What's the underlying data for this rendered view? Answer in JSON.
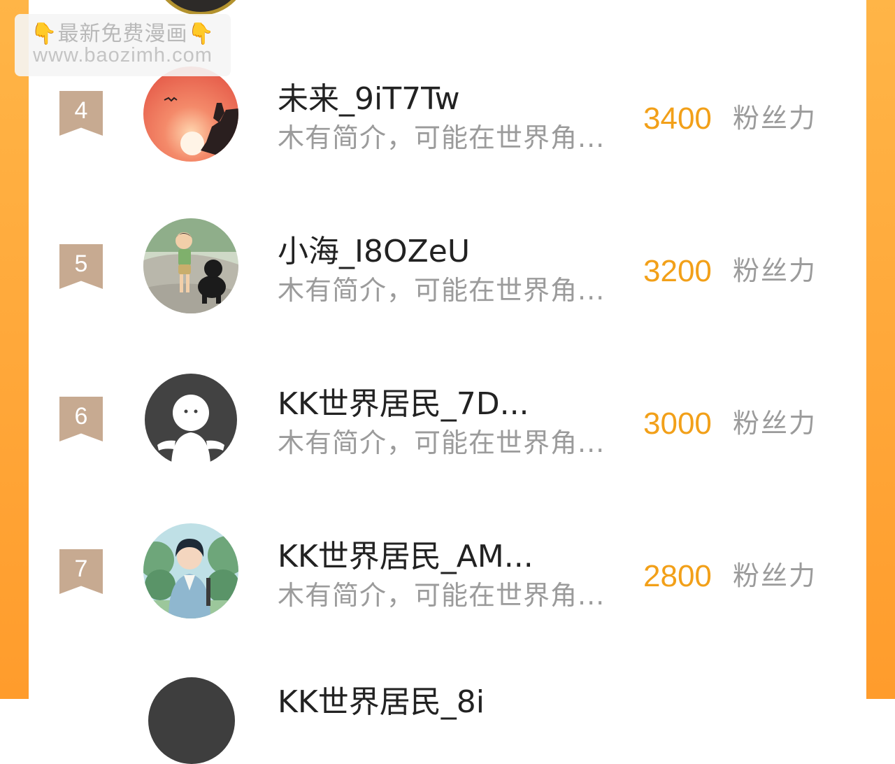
{
  "watermark": {
    "hand_left": "👇",
    "line1": "最新免费漫画",
    "hand_right": "👇",
    "line2": "www.baozimh.com"
  },
  "colors": {
    "frame": "#ffa83a",
    "fans_value": "#f2a019",
    "rank_badge": "#c7aa91",
    "intro_text": "#9b9b9b"
  },
  "ranking": [
    {
      "rank": "4",
      "avatar": "sunset-silhouette-avatar",
      "name": "未来_9iT7Tw",
      "intro": "木有简介，可能在世界角...",
      "fans": "3400",
      "fans_label": "粉丝力"
    },
    {
      "rank": "5",
      "avatar": "boy-with-dog-avatar",
      "name": "小海_I8OZeU",
      "intro": "木有简介，可能在世界角...",
      "fans": "3200",
      "fans_label": "粉丝力"
    },
    {
      "rank": "6",
      "avatar": "default-user-avatar",
      "name": "KK世界居民_7D...",
      "intro": "木有简介，可能在世界角...",
      "fans": "3000",
      "fans_label": "粉丝力"
    },
    {
      "rank": "7",
      "avatar": "anime-boy-avatar",
      "name": "KK世界居民_AM...",
      "intro": "木有简介，可能在世界角...",
      "fans": "2800",
      "fans_label": "粉丝力"
    }
  ],
  "partial_next": {
    "name": "KK世界居民_8i"
  }
}
